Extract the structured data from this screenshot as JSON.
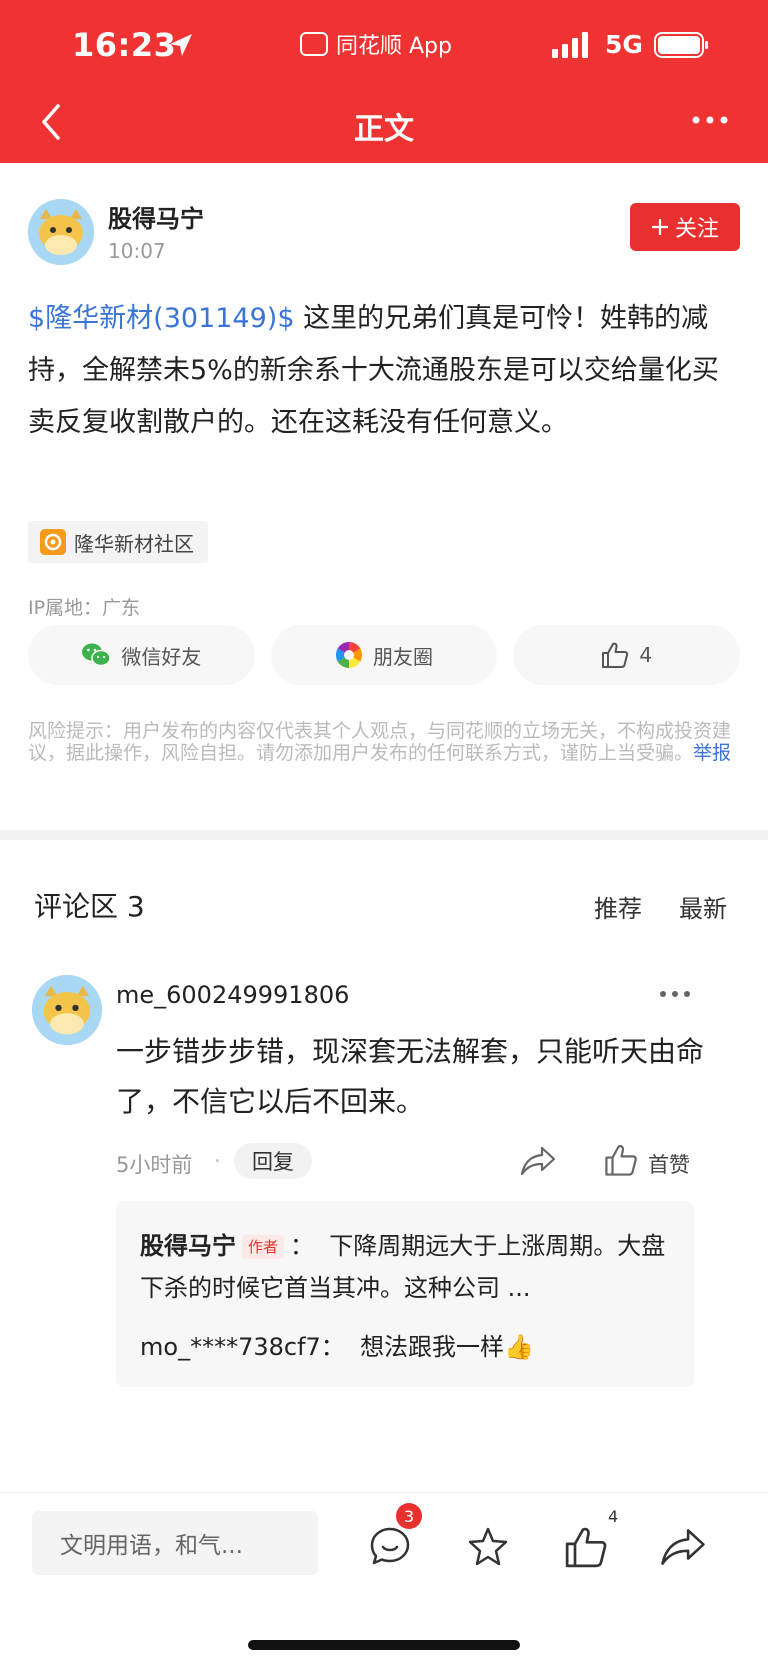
{
  "status_bar": {
    "time": "16:23",
    "app_name": "同花顺 App",
    "network": "5G"
  },
  "nav": {
    "title": "正文"
  },
  "post": {
    "author": "股得马宁",
    "time": "10:07",
    "follow_label": "关注",
    "stock_tag": "$隆华新材(301149)$",
    "body_text": " 这里的兄弟们真是可怜！姓韩的减持，全解禁未5%的新余系十大流通股东是可以交给量化买卖反复收割散户的。还在这耗没有任何意义。",
    "community": "隆华新材社区",
    "ip_location": "IP属地：广东",
    "share": {
      "wechat_label": "微信好友",
      "moments_label": "朋友圈",
      "like_count": "4"
    },
    "risk_notice": "风险提示：用户发布的内容仅代表其个人观点，与同花顺的立场无关，不构成投资建议，据此操作，风险自担。请勿添加用户发布的任何联系方式，谨防上当受骗。",
    "report_label": "举报"
  },
  "comments": {
    "title": "评论区 3",
    "sort_recommend": "推荐",
    "sort_latest": "最新",
    "items": [
      {
        "user": "me_600249991806",
        "text": "一步错步步错，现深套无法解套，只能听天由命了，不信它以后不回来。",
        "time": "5小时前",
        "dot": "·",
        "reply_label": "回复",
        "like_label": "首赞",
        "replies": [
          {
            "user": "股得马宁",
            "badge": "作者",
            "sep": "：",
            "text": "下降周期远大于上涨周期。大盘下杀的时候它首当其冲。这种公司 ..."
          },
          {
            "user": "mo_****738cf7",
            "sep": "：",
            "text": "想法跟我一样👍"
          }
        ]
      }
    ]
  },
  "bottom_bar": {
    "input_placeholder": "文明用语，和气...",
    "comment_count": "3",
    "like_count": "4"
  },
  "colors": {
    "brand_red": "#ef3333",
    "link_blue": "#3a74d8"
  },
  "icons": [
    "location-arrow-icon",
    "signal-icon",
    "battery-icon",
    "back-icon",
    "more-icon",
    "plus-icon",
    "community-icon",
    "wechat-icon",
    "moments-icon",
    "thumbs-up-icon",
    "share-icon",
    "comment-icon",
    "star-icon"
  ]
}
